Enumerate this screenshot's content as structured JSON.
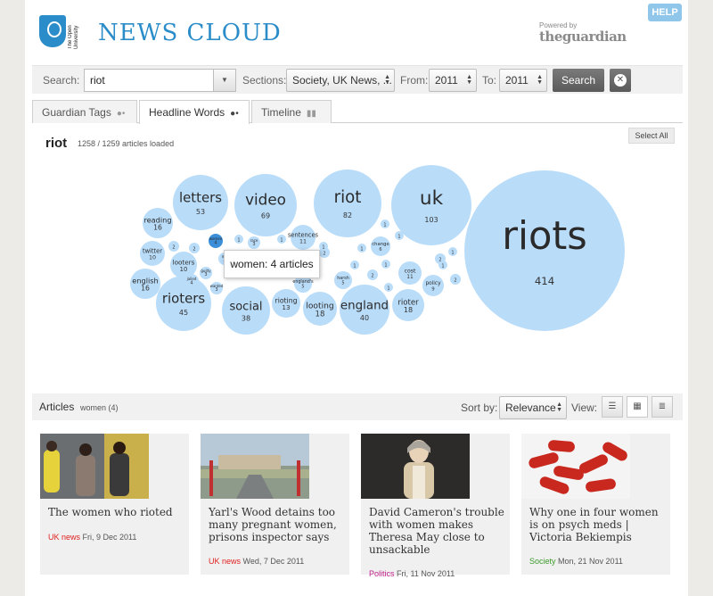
{
  "header": {
    "ou_name": "The Open University",
    "site_title": "NEWS CLOUD",
    "powered_by": "Powered by",
    "guardian": "theguardian",
    "help": "HELP"
  },
  "search": {
    "label": "Search:",
    "value": "riot",
    "sections_label": "Sections:",
    "sections_value": "Society, UK News, ...",
    "from_label": "From:",
    "from_value": "2011",
    "to_label": "To:",
    "to_value": "2011",
    "search_button": "Search"
  },
  "tabs": [
    {
      "label": "Guardian Tags"
    },
    {
      "label": "Headline Words"
    },
    {
      "label": "Timeline"
    }
  ],
  "cloud": {
    "query": "riot",
    "loaded": "1258 / 1259 articles loaded",
    "select_all": "Select All",
    "tooltip": "women: 4 articles",
    "color": "#b9dcf9",
    "highlight_color": "#3b8fd8",
    "bubbles": [
      {
        "word": "riots",
        "count": 414
      },
      {
        "word": "uk",
        "count": 103
      },
      {
        "word": "riot",
        "count": 82
      },
      {
        "word": "video",
        "count": 69
      },
      {
        "word": "letters",
        "count": 53
      },
      {
        "word": "rioters",
        "count": 45
      },
      {
        "word": "england",
        "count": 40
      },
      {
        "word": "social",
        "count": 38
      },
      {
        "word": "looting",
        "count": 18
      },
      {
        "word": "rioter",
        "count": 18
      },
      {
        "word": "reading",
        "count": 16
      },
      {
        "word": "english",
        "count": 16
      },
      {
        "word": "rioting",
        "count": 13
      },
      {
        "word": "sentences",
        "count": 11
      },
      {
        "word": "cost",
        "count": 11
      },
      {
        "word": "twitter",
        "count": 10
      },
      {
        "word": "looters",
        "count": 10
      },
      {
        "word": "policy",
        "count": 9
      },
      {
        "word": "change",
        "count": 6
      },
      {
        "word": "harsh",
        "count": 5
      },
      {
        "word": "england's",
        "count": 5
      },
      {
        "word": "women",
        "count": 4
      },
      {
        "word": "jailed",
        "count": 4
      },
      {
        "word": "race",
        "count": 3
      },
      {
        "word": "guilty",
        "count": 3
      },
      {
        "word": "wanted",
        "count": 3
      },
      {
        "word": "ma",
        "count": 3
      },
      {
        "word": "2",
        "count": 2
      },
      {
        "word": "2",
        "count": 2
      },
      {
        "word": "2",
        "count": 2
      },
      {
        "word": "2",
        "count": 2
      },
      {
        "word": "2",
        "count": 2
      },
      {
        "word": "2",
        "count": 2
      },
      {
        "word": "1",
        "count": 1
      },
      {
        "word": "1",
        "count": 1
      },
      {
        "word": "1",
        "count": 1
      },
      {
        "word": "1",
        "count": 1
      },
      {
        "word": "1",
        "count": 1
      },
      {
        "word": "1",
        "count": 1
      },
      {
        "word": "1",
        "count": 1
      },
      {
        "word": "1",
        "count": 1
      },
      {
        "word": "1",
        "count": 1
      },
      {
        "word": "1",
        "count": 1
      },
      {
        "word": "1",
        "count": 1
      }
    ]
  },
  "articles": {
    "label": "Articles",
    "filter": "women (4)",
    "sort_label": "Sort by:",
    "sort_value": "Relevance",
    "view_label": "View:",
    "items": [
      {
        "headline": "The women who rioted",
        "section": "UK news",
        "section_color": "#e02020",
        "date": "Fri, 9 Dec 2011"
      },
      {
        "headline": "Yarl's Wood detains too many pregnant women, prisons inspector says",
        "section": "UK news",
        "section_color": "#e02020",
        "date": "Wed, 7 Dec 2011"
      },
      {
        "headline": "David Cameron's trouble with women makes Theresa May close to unsackable",
        "section": "Politics",
        "section_color": "#c0208a",
        "date": "Fri, 11 Nov 2011"
      },
      {
        "headline": "Why one in four women is on psych meds | Victoria Bekiempis",
        "section": "Society",
        "section_color": "#3a9a2a",
        "date": "Mon, 21 Nov 2011"
      }
    ]
  }
}
